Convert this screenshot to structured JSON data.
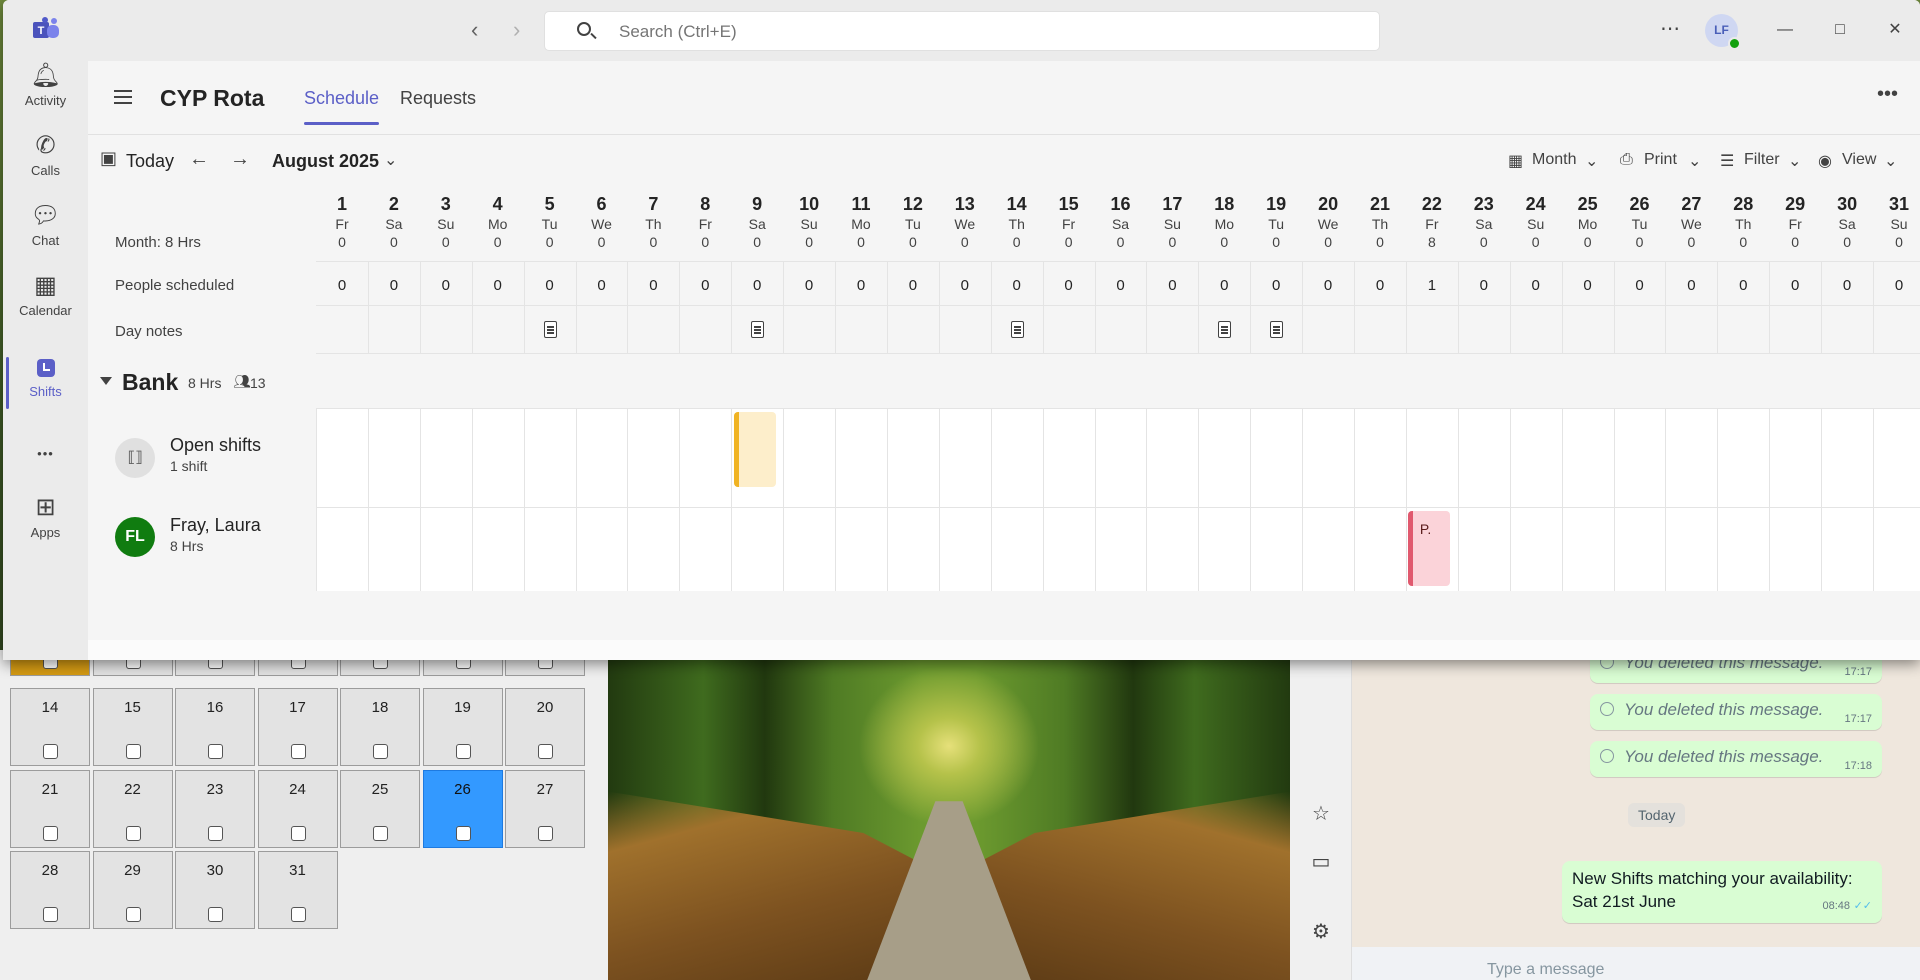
{
  "titlebar": {
    "search_placeholder": "Search (Ctrl+E)",
    "user_initials": "LF",
    "more": "⋯",
    "minimize": "—",
    "maximize": "□",
    "close": "✕"
  },
  "rail": {
    "items": [
      {
        "label": "Activity",
        "icon": "bell-icon"
      },
      {
        "label": "Calls",
        "icon": "phone-icon"
      },
      {
        "label": "Chat",
        "icon": "chat-icon"
      },
      {
        "label": "Calendar",
        "icon": "calendar-icon"
      },
      {
        "label": "Shifts",
        "icon": "shifts-icon"
      },
      {
        "label": "Apps",
        "icon": "add-app-icon"
      }
    ],
    "more": "•••"
  },
  "header": {
    "team_name": "CYP Rota",
    "tabs": [
      "Schedule",
      "Requests"
    ],
    "active_tab": "Schedule"
  },
  "toolbar": {
    "today": "Today",
    "month_label": "August 2025",
    "view_month": "Month",
    "print": "Print",
    "filter": "Filter",
    "view": "View"
  },
  "schedule": {
    "month_hours_label": "Month: 8 Hrs",
    "people_scheduled_label": "People scheduled",
    "day_notes_label": "Day notes",
    "days": [
      {
        "num": "1",
        "dow": "Fr",
        "hrs": "0",
        "people": "0",
        "note": false
      },
      {
        "num": "2",
        "dow": "Sa",
        "hrs": "0",
        "people": "0",
        "note": false
      },
      {
        "num": "3",
        "dow": "Su",
        "hrs": "0",
        "people": "0",
        "note": false
      },
      {
        "num": "4",
        "dow": "Mo",
        "hrs": "0",
        "people": "0",
        "note": false
      },
      {
        "num": "5",
        "dow": "Tu",
        "hrs": "0",
        "people": "0",
        "note": true
      },
      {
        "num": "6",
        "dow": "We",
        "hrs": "0",
        "people": "0",
        "note": false
      },
      {
        "num": "7",
        "dow": "Th",
        "hrs": "0",
        "people": "0",
        "note": false
      },
      {
        "num": "8",
        "dow": "Fr",
        "hrs": "0",
        "people": "0",
        "note": false
      },
      {
        "num": "9",
        "dow": "Sa",
        "hrs": "0",
        "people": "0",
        "note": true
      },
      {
        "num": "10",
        "dow": "Su",
        "hrs": "0",
        "people": "0",
        "note": false
      },
      {
        "num": "11",
        "dow": "Mo",
        "hrs": "0",
        "people": "0",
        "note": false
      },
      {
        "num": "12",
        "dow": "Tu",
        "hrs": "0",
        "people": "0",
        "note": false
      },
      {
        "num": "13",
        "dow": "We",
        "hrs": "0",
        "people": "0",
        "note": false
      },
      {
        "num": "14",
        "dow": "Th",
        "hrs": "0",
        "people": "0",
        "note": true
      },
      {
        "num": "15",
        "dow": "Fr",
        "hrs": "0",
        "people": "0",
        "note": false
      },
      {
        "num": "16",
        "dow": "Sa",
        "hrs": "0",
        "people": "0",
        "note": false
      },
      {
        "num": "17",
        "dow": "Su",
        "hrs": "0",
        "people": "0",
        "note": false
      },
      {
        "num": "18",
        "dow": "Mo",
        "hrs": "0",
        "people": "0",
        "note": true
      },
      {
        "num": "19",
        "dow": "Tu",
        "hrs": "0",
        "people": "0",
        "note": true
      },
      {
        "num": "20",
        "dow": "We",
        "hrs": "0",
        "people": "0",
        "note": false
      },
      {
        "num": "21",
        "dow": "Th",
        "hrs": "0",
        "people": "0",
        "note": false
      },
      {
        "num": "22",
        "dow": "Fr",
        "hrs": "8",
        "people": "1",
        "note": false
      },
      {
        "num": "23",
        "dow": "Sa",
        "hrs": "0",
        "people": "0",
        "note": false
      },
      {
        "num": "24",
        "dow": "Su",
        "hrs": "0",
        "people": "0",
        "note": false
      },
      {
        "num": "25",
        "dow": "Mo",
        "hrs": "0",
        "people": "0",
        "note": false
      },
      {
        "num": "26",
        "dow": "Tu",
        "hrs": "0",
        "people": "0",
        "note": false
      },
      {
        "num": "27",
        "dow": "We",
        "hrs": "0",
        "people": "0",
        "note": false
      },
      {
        "num": "28",
        "dow": "Th",
        "hrs": "0",
        "people": "0",
        "note": false
      },
      {
        "num": "29",
        "dow": "Fr",
        "hrs": "0",
        "people": "0",
        "note": false
      },
      {
        "num": "30",
        "dow": "Sa",
        "hrs": "0",
        "people": "0",
        "note": false
      },
      {
        "num": "31",
        "dow": "Su",
        "hrs": "0",
        "people": "0",
        "note": false
      }
    ],
    "group": {
      "name": "Bank",
      "hours": "8 Hrs",
      "member_count": "13"
    },
    "open_shifts": {
      "title": "Open shifts",
      "sub": "1 shift",
      "shift_day": "9",
      "color": "#f0b323"
    },
    "person": {
      "initials": "FL",
      "name": "Fray, Laura",
      "hours": "8 Hrs",
      "avatar_color": "#107c10",
      "shift_day": "22",
      "shift_label": "P.",
      "shift_color": "#e0596e"
    }
  },
  "background_calendar": {
    "weeks": [
      [
        "14",
        "15",
        "16",
        "17",
        "18",
        "19",
        "20"
      ],
      [
        "21",
        "22",
        "23",
        "24",
        "25",
        "26",
        "27"
      ],
      [
        "28",
        "29",
        "30",
        "31"
      ]
    ],
    "selected_day": "26"
  },
  "whatsapp": {
    "deleted_messages": [
      {
        "text": "You deleted this message.",
        "time": "17:17"
      },
      {
        "text": "You deleted this message.",
        "time": "17:17"
      },
      {
        "text": "You deleted this message.",
        "time": "17:18"
      }
    ],
    "date_divider": "Today",
    "last_message": "New Shifts matching your availability: Sat 21st June",
    "last_message_time": "08:48",
    "input_placeholder": "Type a message"
  }
}
